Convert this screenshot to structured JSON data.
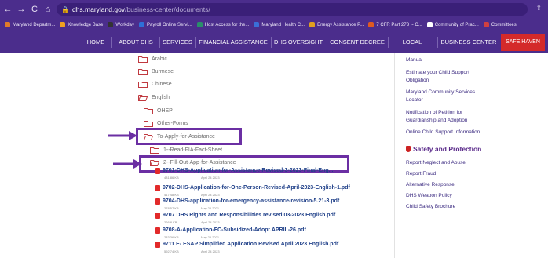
{
  "browser": {
    "nav_back": "←",
    "nav_forward": "→",
    "nav_reload": "C",
    "nav_home": "⌂",
    "url_host": "dhs.maryland.gov",
    "url_path": "/business-center/documents/",
    "share_icon": "⇪"
  },
  "bookmarks": [
    {
      "label": "Maryland Departm...",
      "color": "#e07b2a"
    },
    {
      "label": "Knowledge Base",
      "color": "#f0a020"
    },
    {
      "label": "Workday",
      "color": "#333"
    },
    {
      "label": "Payroll Online Servi...",
      "color": "#2e6fd8"
    },
    {
      "label": "Host Access for the...",
      "color": "#2a8f6a"
    },
    {
      "label": "Maryland Health C...",
      "color": "#3a6fd8"
    },
    {
      "label": "Energy Assistance P...",
      "color": "#e0a020"
    },
    {
      "label": "7 CFR Part 273 -- C...",
      "color": "#e05a20"
    },
    {
      "label": "Community of Prac...",
      "color": "#ffffff"
    },
    {
      "label": "Committees",
      "color": "#d04040"
    }
  ],
  "site_nav": {
    "home": "HOME",
    "about": "ABOUT DHS",
    "services": "SERVICES",
    "financial": "FINANCIAL ASSISTANCE",
    "oversight": "DHS OVERSIGHT",
    "consent": "CONSENT DECREE",
    "offices": "LOCAL OFFICES",
    "business": "BUSINESS CENTER",
    "safe": "SAFE HAVEN"
  },
  "tree": {
    "arabic": "Arabic",
    "burmese": "Burmese",
    "chinese": "Chinese",
    "english": "English",
    "ohep": "OHEP",
    "other_forms": "Other-Forms",
    "to_apply": "To-Apply-for-Assistance",
    "read_fia": "1--Read-FIA-Fact-Sheet",
    "fill_out": "2--Fill-Out-App-for-Assistance"
  },
  "files": [
    {
      "name": "9701-DHS-Application-for-Assistance-Revised-3-2023-Final-Eng...",
      "size": "481.86 KB",
      "date": "April 24 2023"
    },
    {
      "name": "9702-DHS-Application-for-One-Person-Revised-April-2023-English-1.pdf",
      "size": "417.48 KB",
      "date": "April 24 2023"
    },
    {
      "name": "9704-DHS-application-for-emergency-assistance-revision-5.21-3.pdf",
      "size": "278.57 KB",
      "date": "May 25 2021"
    },
    {
      "name": "9707 DHS Rights and Responsibilities revised 03-2023 English.pdf",
      "size": "226.8 KB",
      "date": "April 24 2023"
    },
    {
      "name": "9708-A-Application-FC-Subsidized-Adopt.APRIL-26.pdf",
      "size": "283.36 KB",
      "date": "May 25 2021"
    },
    {
      "name": "9711 E- ESAP Simplified Application Revised April 2023 English.pdf",
      "size": "592.74 KB",
      "date": "April 24 2023"
    }
  ],
  "sidebar": {
    "manual": "Manual",
    "estimate_1": "Estimate your Child Support",
    "estimate_2": "Obligation",
    "locator_1": "Maryland Community Services",
    "locator_2": "Locator",
    "notification_1": "Notification of Petition for",
    "notification_2": "Guardianship and Adoption",
    "online_child": "Online Child Support Information",
    "safety_heading": "Safety and Protection",
    "report_neglect": "Report Neglect and Abuse",
    "report_fraud": "Report Fraud",
    "alt_response": "Alternative Response",
    "weapon_policy": "DHS Weapon Policy",
    "child_safety": "Child Safety Brochure"
  },
  "colors": {
    "brand_purple": "#4b2d8c",
    "highlight_purple": "#6b2fa3",
    "safe_haven_red": "#d42a2a",
    "folder_red": "#c0393f",
    "link_blue": "#22428a"
  }
}
